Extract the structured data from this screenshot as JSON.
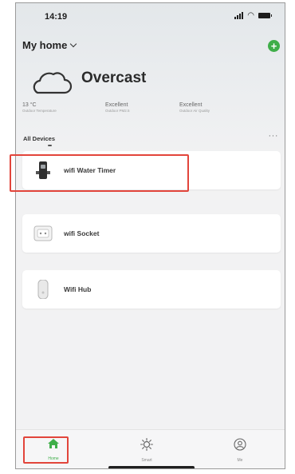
{
  "status_bar": {
    "time": "14:19"
  },
  "header": {
    "home_title": "My home",
    "add_label": "+"
  },
  "weather": {
    "condition": "Overcast",
    "stats": [
      {
        "value": "13 °C",
        "label": "Outdoor Temperature"
      },
      {
        "value": "Excellent",
        "label": "Outdoor PM2.5"
      },
      {
        "value": "Excellent",
        "label": "Outdoor Air Quality"
      }
    ]
  },
  "devices": {
    "section_title": "All Devices",
    "more_label": "···",
    "items": [
      {
        "name": "wifi Water Timer",
        "icon": "water-timer-icon"
      },
      {
        "name": "wifi Socket",
        "icon": "socket-icon"
      },
      {
        "name": "Wifi Hub",
        "icon": "hub-icon"
      }
    ]
  },
  "tabbar": {
    "tabs": [
      {
        "label": "Home",
        "icon": "home-icon"
      },
      {
        "label": "Smart",
        "icon": "smart-icon"
      },
      {
        "label": "Me",
        "icon": "me-icon"
      }
    ]
  },
  "colors": {
    "accent": "#3fae49",
    "highlight": "#e2453b",
    "background": "#f2f2f3"
  }
}
